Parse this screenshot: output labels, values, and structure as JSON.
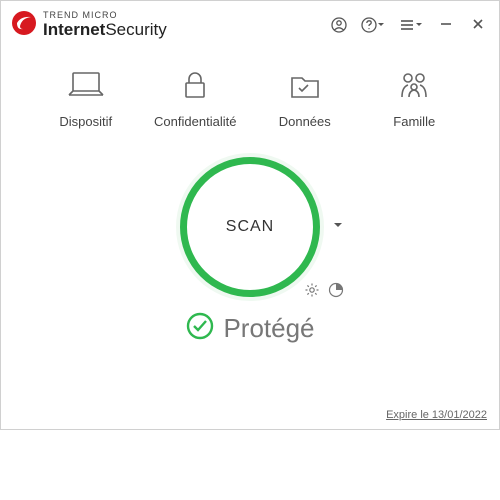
{
  "brand": {
    "small": "TREND MICRO",
    "bold": "Internet",
    "light": "Security"
  },
  "nav": {
    "device": "Dispositif",
    "privacy": "Confidentialité",
    "data": "Données",
    "family": "Famille"
  },
  "scan": {
    "label": "SCAN"
  },
  "status": {
    "text": "Protégé"
  },
  "footer": {
    "expiry": "Expire le 13/01/2022"
  }
}
